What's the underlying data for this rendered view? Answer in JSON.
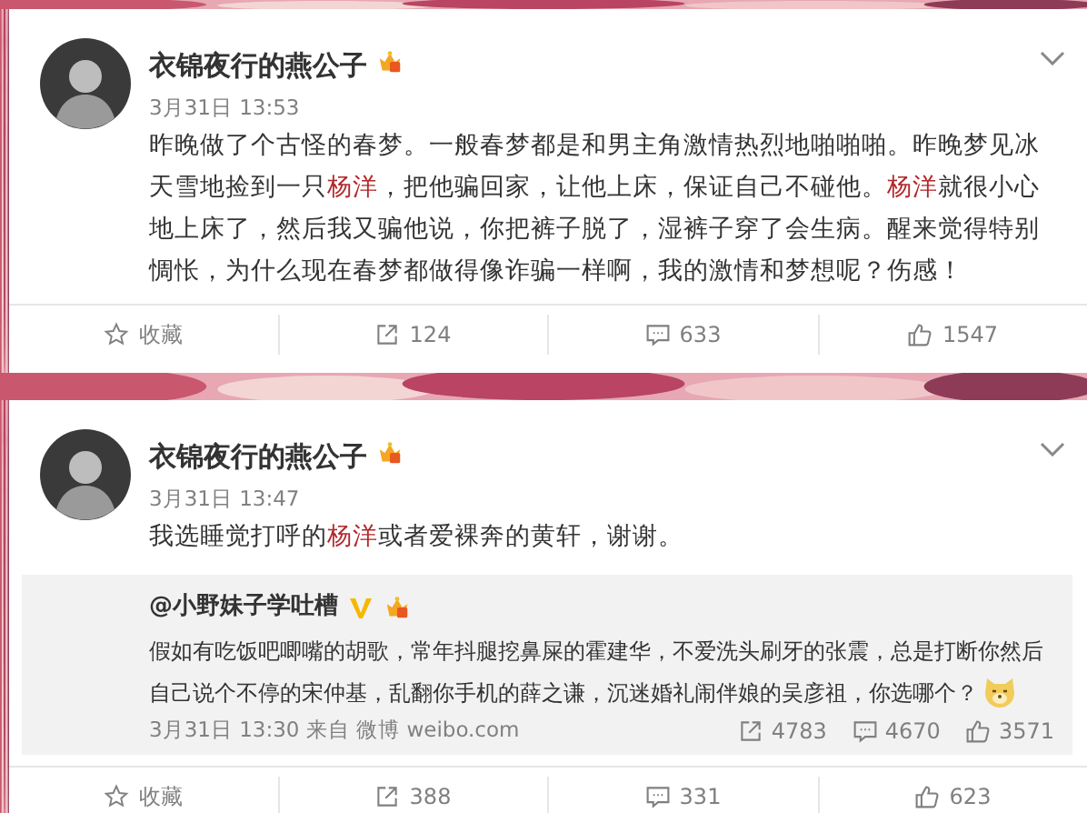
{
  "posts": [
    {
      "author": "衣锦夜行的燕公子",
      "time": "3月31日 13:53",
      "text": [
        {
          "text": "昨晚做了个古怪的春梦。一般春梦都是和男主角激情热烈地啪啪啪。昨晚梦见冰天雪地捡到一只",
          "highlight": false
        },
        {
          "text": "杨洋",
          "highlight": true
        },
        {
          "text": "，把他骗回家，让他上床，保证自己不碰他。",
          "highlight": false
        },
        {
          "text": "杨洋",
          "highlight": true
        },
        {
          "text": "就很小心地上床了，然后我又骗他说，你把裤子脱了，湿裤子穿了会生病。醒来觉得特别惆怅，为什么现在春梦都做得像诈骗一样啊，我的激情和梦想呢？伤感！",
          "highlight": false
        }
      ],
      "actions": [
        {
          "kind": "favorite",
          "label": "收藏"
        },
        {
          "kind": "repost",
          "label": "124"
        },
        {
          "kind": "comment",
          "label": "633"
        },
        {
          "kind": "like",
          "label": "1547"
        }
      ]
    },
    {
      "author": "衣锦夜行的燕公子",
      "time": "3月31日 13:47",
      "text": [
        {
          "text": "我选睡觉打呼的",
          "highlight": false
        },
        {
          "text": "杨洋",
          "highlight": true
        },
        {
          "text": "或者爱裸奔的黄轩，谢谢。",
          "highlight": false
        }
      ],
      "repost": {
        "author": "@小野妹子学吐槽",
        "verified": true,
        "text": "假如有吃饭吧唧嘴的胡歌，常年抖腿挖鼻屎的霍建华，不爱洗头刷牙的张震，总是打断你然后自己说个不停的宋仲基，乱翻你手机的薛之谦，沉迷婚礼闹伴娘的吴彦祖，你选哪个？",
        "meta": "3月31日 13:30 来自 微博 weibo.com",
        "stats": [
          {
            "kind": "repost",
            "label": "4783"
          },
          {
            "kind": "comment",
            "label": "4670"
          },
          {
            "kind": "like",
            "label": "3571"
          }
        ]
      },
      "actions": [
        {
          "kind": "favorite",
          "label": "收藏"
        },
        {
          "kind": "repost",
          "label": "388"
        },
        {
          "kind": "comment",
          "label": "331"
        },
        {
          "kind": "like",
          "label": "623"
        }
      ]
    }
  ]
}
